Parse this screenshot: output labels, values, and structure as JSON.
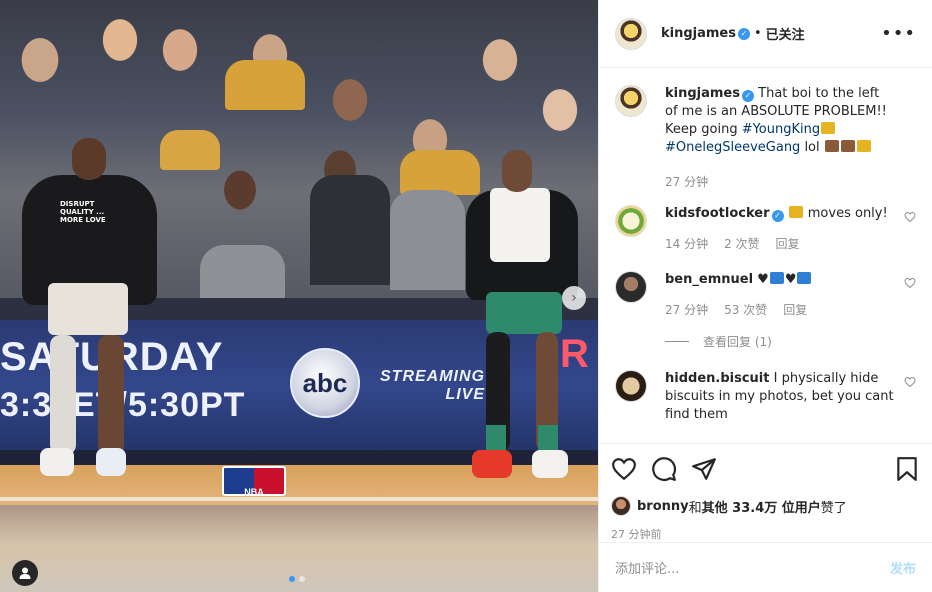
{
  "photo": {
    "banner_day": "SATURDAY",
    "banner_time": "3:30ET/5:30PT",
    "banner_streaming": "STREAMING",
    "banner_live": "LIVE",
    "network_logo": "abc",
    "red_sign": "R",
    "nba_logo": "NBA",
    "shirt_text": "DISRUPT QUALITY ... MORE LOVE",
    "carousel": {
      "count": 2,
      "active_index": 0
    }
  },
  "header": {
    "username": "kingjames",
    "separator": "•",
    "follow_state": "已关注",
    "more_icon": "more-horizontal-icon"
  },
  "caption": {
    "username": "kingjames",
    "text_before": "That boi to the left of me is an ABSOLUTE PROBLEM!! Keep going ",
    "hashtag1": "#YoungKing",
    "hashtag2": "#OnelegSleeveGang",
    "text_after": " lol ",
    "time": "27 分钟"
  },
  "comments": [
    {
      "username": "kidsfootlocker",
      "text": " moves only!",
      "time": "14 分钟",
      "likes": "2 次赞",
      "reply": "回复"
    },
    {
      "username": "ben_emnuel",
      "text": "",
      "time": "27 分钟",
      "likes": "53 次赞",
      "reply": "回复"
    },
    {
      "username": "hidden.biscuit",
      "text": "I physically hide biscuits in my photos, bet you cant find them"
    }
  ],
  "view_replies": "查看回复 (1)",
  "actions": {
    "like_icon": "heart-icon",
    "comment_icon": "comment-bubble-icon",
    "share_icon": "paper-plane-icon",
    "save_icon": "bookmark-icon"
  },
  "likes": {
    "liker": "bronny",
    "connector": " 和 ",
    "others_label": "其他 33.4万 位用户",
    "suffix": " 赞了"
  },
  "post_time": "27 分钟前",
  "add_comment": {
    "placeholder": "添加评论...",
    "post_label": "发布"
  },
  "colors": {
    "link": "#00376b",
    "verified": "#3897f0",
    "muted": "#8e8e8e",
    "post_disabled": "#b2dffc"
  }
}
